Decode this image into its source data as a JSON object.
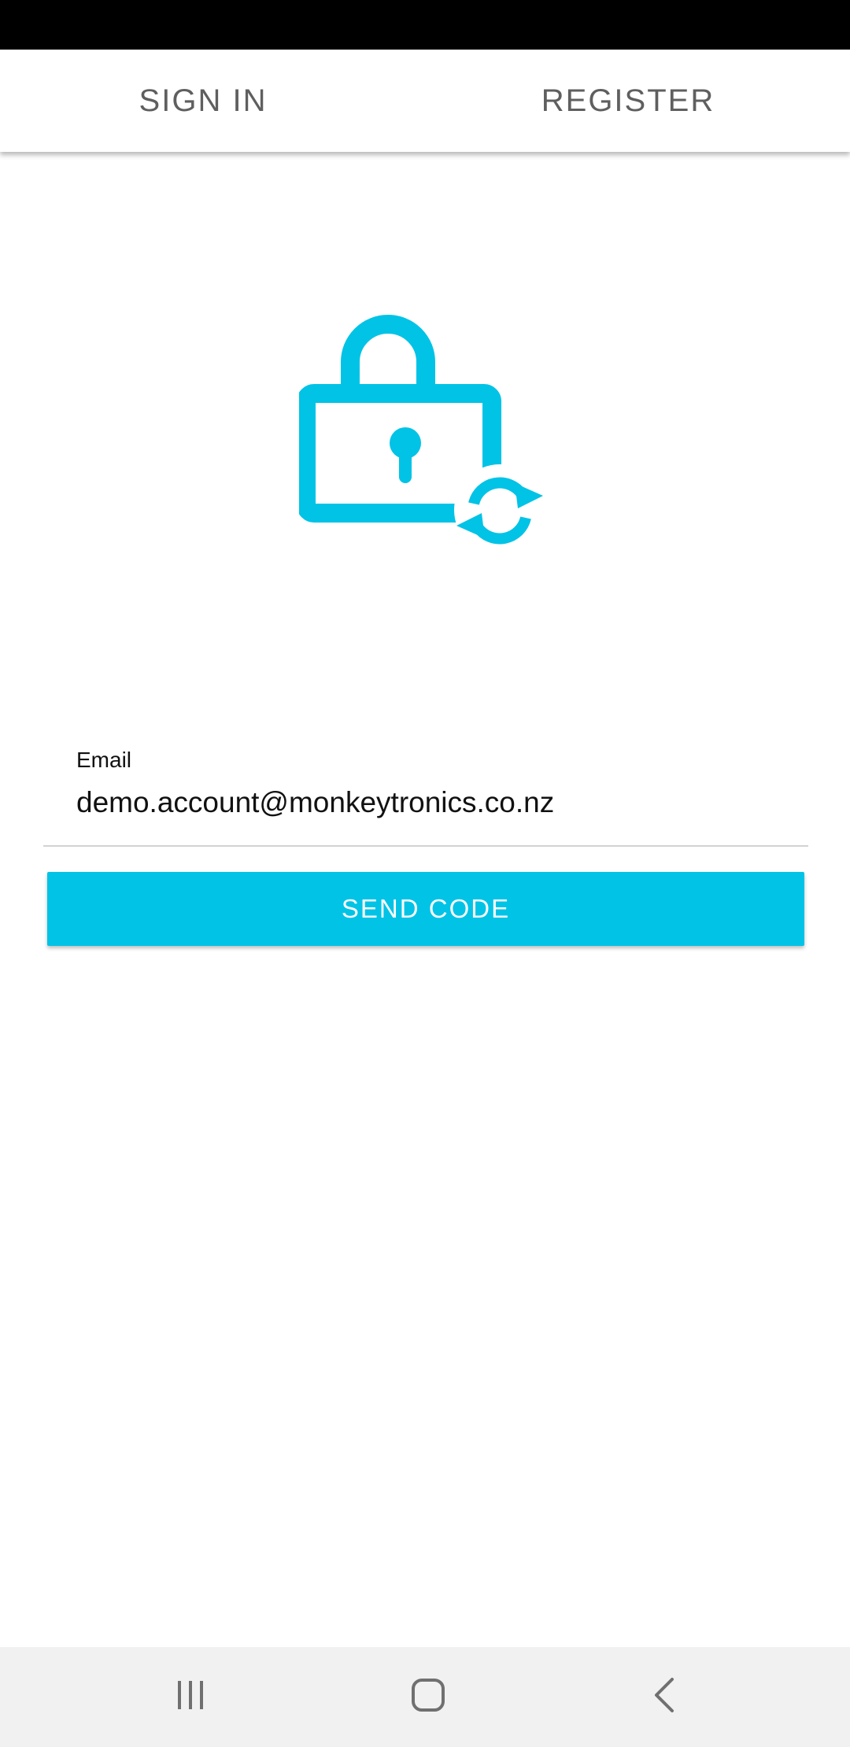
{
  "tabs": {
    "sign_in": "SIGN IN",
    "register": "REGISTER"
  },
  "form": {
    "email_label": "Email",
    "email_value": "demo.account@monkeytronics.co.nz",
    "send_code_label": "SEND CODE"
  },
  "icons": {
    "hero": "lock-reset-icon",
    "nav_recents": "recents-icon",
    "nav_home": "home-icon",
    "nav_back": "back-icon"
  },
  "colors": {
    "accent": "#00c3e6",
    "tab_text": "#5f5f5f",
    "nav_bar": "#f1f1f1"
  }
}
